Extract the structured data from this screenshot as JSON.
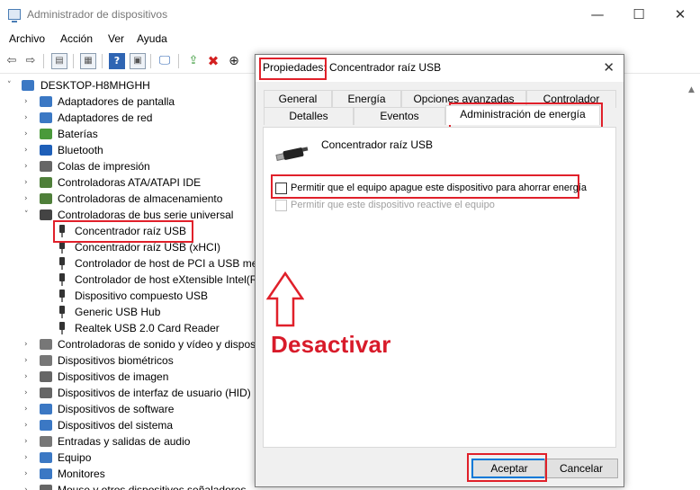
{
  "window": {
    "title": "Administrador de dispositivos",
    "controls": {
      "minimize": "—",
      "maximize": "☐",
      "close": "✕"
    }
  },
  "menu": [
    "Archivo",
    "Acción",
    "Ver",
    "Ayuda"
  ],
  "toolbar_icons": [
    "back-arrow-icon",
    "forward-arrow-icon",
    "show-hide-icon",
    "properties-icon",
    "help-icon",
    "view-icon",
    "monitor-icon",
    "update-driver-icon",
    "uninstall-icon",
    "download-icon"
  ],
  "tree": {
    "root": "DESKTOP-H8MHGHH",
    "categories": [
      {
        "label": "Adaptadores de pantalla",
        "icon": "display-adapter-icon",
        "color": "#3b78c4"
      },
      {
        "label": "Adaptadores de red",
        "icon": "network-adapter-icon",
        "color": "#3b78c4"
      },
      {
        "label": "Baterías",
        "icon": "battery-icon",
        "color": "#4a9a3b"
      },
      {
        "label": "Bluetooth",
        "icon": "bluetooth-icon",
        "color": "#1e5fb8"
      },
      {
        "label": "Colas de impresión",
        "icon": "printer-icon",
        "color": "#666666"
      },
      {
        "label": "Controladoras ATA/ATAPI IDE",
        "icon": "ide-controller-icon",
        "color": "#4f7f3a"
      },
      {
        "label": "Controladoras de almacenamiento",
        "icon": "storage-controller-icon",
        "color": "#4f7f3a"
      },
      {
        "label": "Controladoras de bus serie universal",
        "icon": "usb-controller-icon",
        "color": "#444444"
      }
    ],
    "usb_children": [
      "Concentrador raíz USB",
      "Concentrador raíz USB (xHCI)",
      "Controlador de host de PCI a USB mej",
      "Controlador de host eXtensible Intel(R",
      "Dispositivo compuesto USB",
      "Generic USB Hub",
      "Realtek USB 2.0 Card Reader"
    ],
    "categories_after": [
      {
        "label": "Controladoras de sonido y vídeo y dispos",
        "icon": "sound-icon",
        "color": "#777777"
      },
      {
        "label": "Dispositivos biométricos",
        "icon": "biometric-icon",
        "color": "#777777"
      },
      {
        "label": "Dispositivos de imagen",
        "icon": "camera-icon",
        "color": "#666666"
      },
      {
        "label": "Dispositivos de interfaz de usuario (HID)",
        "icon": "hid-icon",
        "color": "#666666"
      },
      {
        "label": "Dispositivos de software",
        "icon": "software-device-icon",
        "color": "#3b78c4"
      },
      {
        "label": "Dispositivos del sistema",
        "icon": "system-device-icon",
        "color": "#3b78c4"
      },
      {
        "label": "Entradas y salidas de audio",
        "icon": "audio-io-icon",
        "color": "#777777"
      },
      {
        "label": "Equipo",
        "icon": "computer-icon",
        "color": "#3b78c4"
      },
      {
        "label": "Monitores",
        "icon": "monitor-icon",
        "color": "#3b78c4"
      },
      {
        "label": "Mouse y otros dispositivos señaladores",
        "icon": "mouse-icon",
        "color": "#666666"
      }
    ]
  },
  "dialog": {
    "title_prefix": "Propiedades:",
    "title_device": " Concentrador raíz USB",
    "close": "✕",
    "tabs_row1": [
      "General",
      "Energía",
      "Opciones avanzadas",
      "Controlador"
    ],
    "tabs_row2": [
      "Detalles",
      "Eventos",
      "Administración de energía"
    ],
    "active_tab": "Administración de energía",
    "device_name": "Concentrador raíz USB",
    "option_allow_off": "Permitir que el equipo apague este dispositivo para ahorrar energía",
    "option_wake": "Permitir que este dispositivo reactive el equipo",
    "ok": "Aceptar",
    "cancel": "Cancelar"
  },
  "annotation": {
    "text": "Desactivar",
    "color": "#d81b2a"
  }
}
